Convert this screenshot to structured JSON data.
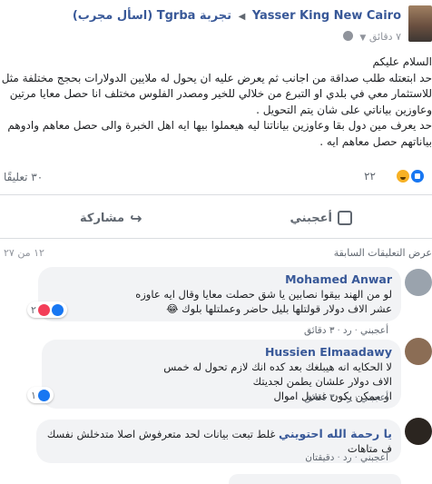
{
  "post": {
    "author": "Yasser King New Cairo",
    "group": "تجربة Tgrba (اسأل مجرب)",
    "time": "٧ دقائق",
    "body_lines": [
      "السلام عليكم",
      "حد ابتعتله طلب صداقة من اجانب ثم يعرض عليه ان يحول له ملايين الدولارات بحجج مختلفة مثل",
      "للاستثمار معي في بلدي او التبرع من خلالي للخير ومصدر الفلوس مختلف انا حصل معايا مرتين",
      "وعاوزين بياناتي على شان يتم التحويل .",
      "حد يعرف مين دول بقا وعاوزين بياناتنا ليه هيعملوا بيها ايه اهل الخبرة والى حصل معاهم وادوهم",
      "بياناتهم حصل معاهم ايه ."
    ],
    "reaction_count": "٢٢",
    "comments_count": "٣٠ تعليقًا",
    "like_label": "أعجبني",
    "share_label": "مشاركة"
  },
  "comments_section": {
    "previous_label": "عرض التعليقات السابقة",
    "count_label": "١٢ من ٢٧"
  },
  "comments": [
    {
      "author": "Mohamed Anwar",
      "text_lines": [
        "لو من الهند بيقوا نصابين يا شق حصلت معايا وقال ايه عاوزه",
        "عشر الاف دولار قولتلها بليل حاضر وعملتلها بلوك 😂"
      ],
      "like": "أعجبني",
      "reply": "رد",
      "time": "٣ دقائق",
      "reactions": "٢"
    },
    {
      "author": "Hussien Elmaadawy",
      "text_lines": [
        "لا الحكايه انه هيبلغك بعد كده انك لازم تحول له خمس",
        "الاف دولار علشان يطمن لجديتك",
        "او ممكن يكون غسيل اموال"
      ],
      "like": "أعجبني",
      "reply": "رد",
      "time": "٣ دقائق",
      "reactions": "١"
    },
    {
      "author": "يا رحمة الله احتويني",
      "text_lines": [
        "غلط تبعت بيانات لحد متعرفوش اصلا متدخلش نفسك ف متاهات"
      ],
      "like": "أعجبني",
      "reply": "رد",
      "time": "دقيقتان"
    }
  ],
  "colors": {
    "link": "#385898",
    "bubble": "#f2f3f5",
    "like_blue": "#1877f2",
    "haha_yellow": "#f7b125",
    "love_red": "#f33e58"
  },
  "icons": [
    "globe-icon",
    "like-icon",
    "haha-icon",
    "love-icon",
    "share-icon",
    "thumb-icon"
  ]
}
